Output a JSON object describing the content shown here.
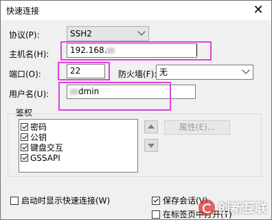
{
  "window": {
    "title": "快速连接"
  },
  "protocol": {
    "label": "协议(P):",
    "value": "SSH2"
  },
  "hostname": {
    "label": "主机名(H):",
    "value_prefix": "192.168.",
    "value_suffix": ""
  },
  "port": {
    "label": "端口(O):",
    "value": "22"
  },
  "firewall": {
    "label": "防火墙(F):",
    "value": "无"
  },
  "username": {
    "label": "用户名(U):",
    "value_suffix": "dmin"
  },
  "auth": {
    "group_label": "鉴权",
    "methods": [
      {
        "label": "密码",
        "checked": true
      },
      {
        "label": "公钥",
        "checked": true
      },
      {
        "label": "键盘交互",
        "checked": true
      },
      {
        "label": "GSSAPI",
        "checked": true
      }
    ],
    "properties_button": "属性(E)..."
  },
  "footer": {
    "show_on_startup": {
      "label": "启动时显示快速连接(W)",
      "checked": false
    },
    "save_session": {
      "label": "保存会话(V)",
      "checked": true
    },
    "open_in_tab": {
      "label": "在标签页中打开(T)",
      "checked": false
    }
  },
  "watermark": {
    "text": "创新互联"
  },
  "colors": {
    "highlight": "#e040e0",
    "dialog_bg": "#f0f0f0"
  }
}
